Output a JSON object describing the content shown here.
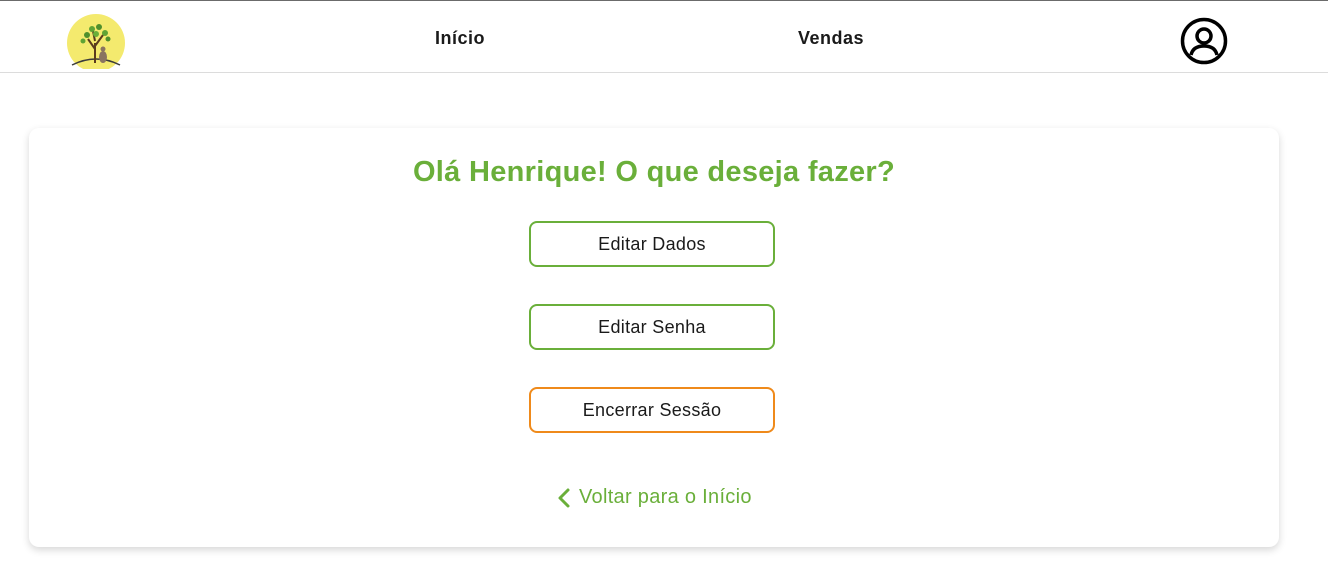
{
  "nav": {
    "links": [
      {
        "label": "Início"
      },
      {
        "label": "Vendas"
      }
    ],
    "logo_icon": "tree-logo-icon",
    "account_icon": "user-circle-icon"
  },
  "main": {
    "title": "Olá Henrique! O que deseja fazer?",
    "actions": [
      {
        "label": "Editar Dados"
      },
      {
        "label": "Editar Senha"
      },
      {
        "label": "Encerrar Sessão"
      }
    ],
    "back_link": {
      "label": "Voltar para o Início",
      "icon": "chevron-left-icon"
    }
  },
  "colors": {
    "accent_green": "#6aaf3a",
    "accent_orange": "#ef8a1b",
    "logo_yellow": "#f4ea6e"
  }
}
